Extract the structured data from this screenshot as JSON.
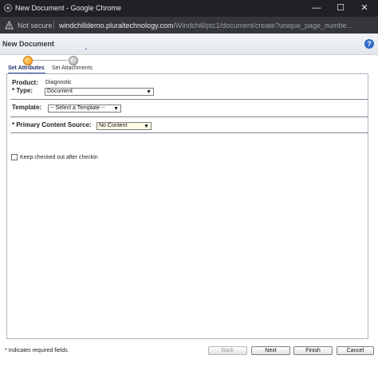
{
  "window": {
    "title": "New Document - Google Chrome",
    "controls": {
      "minimize": "—",
      "maximize": "☐",
      "close": "✕"
    }
  },
  "address_bar": {
    "security": "Not secure",
    "url_host": "windchilldemo.pluraltechnology.com",
    "url_path": "/Windchill/ptc1/document/create?unique_page_numbe..."
  },
  "page": {
    "title": "New Document",
    "help_icon": "?"
  },
  "wizard": {
    "steps": [
      {
        "label": "Set Attributes",
        "state": "active",
        "icon": "step-active-icon"
      },
      {
        "label": "Set Attachments",
        "state": "pending",
        "icon": "step-pending-icon"
      }
    ]
  },
  "form": {
    "product_label": "Product:",
    "product_value": "Diagnostic",
    "type_label": "* Type:",
    "type_value": "Document",
    "template_label": "Template:",
    "template_value": "-- Select a Template --",
    "primary_source_label": "* Primary Content Source:",
    "primary_source_value": "No Content",
    "keep_checked_out_label": "Keep checked out after checkin",
    "keep_checked_out_checked": false
  },
  "footer": {
    "required_note": "* Indicates required fields.",
    "buttons": {
      "back": "Back",
      "next": "Next",
      "finish": "Finish",
      "cancel": "Cancel"
    }
  },
  "colors": {
    "titlebar_bg": "#202124",
    "addressbar_bg": "#35363a",
    "active_step": "#f29a14",
    "help_icon_bg": "#2f6bc4",
    "primary_source_bg": "#fffbe6"
  }
}
